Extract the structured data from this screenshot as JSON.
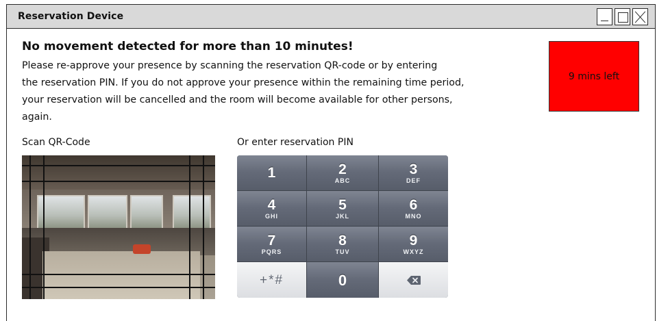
{
  "window": {
    "title": "Reservation Device",
    "controls": {
      "minimize_icon": "minimize-icon",
      "maximize_icon": "maximize-icon",
      "close_icon": "close-icon"
    }
  },
  "alert": {
    "heading": "No movement detected for more than 10 minutes!",
    "lines": [
      "Please re-approve your presence by scanning the reservation QR-code or by entering",
      "the reservation PIN. If you do not approve your presence within the remaining time period,",
      "your reservation will be cancelled and the room will become available for other persons,",
      "again."
    ]
  },
  "timer": {
    "label": "9 mins left",
    "color": "#ff0000"
  },
  "qr": {
    "label": "Scan QR-Code"
  },
  "pin": {
    "label": "Or enter reservation PIN",
    "keys": [
      {
        "num": "1",
        "letters": ""
      },
      {
        "num": "2",
        "letters": "ABC"
      },
      {
        "num": "3",
        "letters": "DEF"
      },
      {
        "num": "4",
        "letters": "GHI"
      },
      {
        "num": "5",
        "letters": "JKL"
      },
      {
        "num": "6",
        "letters": "MNO"
      },
      {
        "num": "7",
        "letters": "PQRS"
      },
      {
        "num": "8",
        "letters": "TUV"
      },
      {
        "num": "9",
        "letters": "WXYZ"
      },
      {
        "num": "+*#",
        "letters": ""
      },
      {
        "num": "0",
        "letters": ""
      },
      {
        "num": "",
        "letters": "",
        "icon": "backspace-icon"
      }
    ]
  }
}
